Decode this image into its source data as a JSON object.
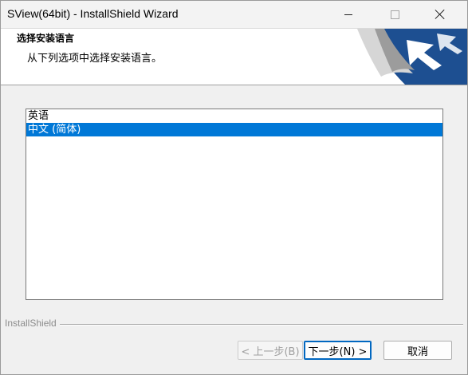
{
  "window": {
    "title": "SView(64bit) - InstallShield Wizard"
  },
  "title_controls": {
    "minimize_icon": "minimize-icon",
    "maximize_icon": "maximize-icon",
    "close_icon": "close-icon"
  },
  "header": {
    "heading": "选择安装语言",
    "subheading": "从下列选项中选择安装语言。",
    "logo_colors": {
      "blue": "#1d4f91",
      "silver": "#c8c8c8"
    }
  },
  "language_list": {
    "items": [
      {
        "label": "英语",
        "selected": false
      },
      {
        "label": "中文 (简体)",
        "selected": true
      }
    ],
    "selection_color": "#0078d7"
  },
  "branding": {
    "text": "InstallShield"
  },
  "buttons": {
    "back_label": "< 上一步(B)",
    "next_label": "下一步(N) >",
    "cancel_label": "取消"
  }
}
